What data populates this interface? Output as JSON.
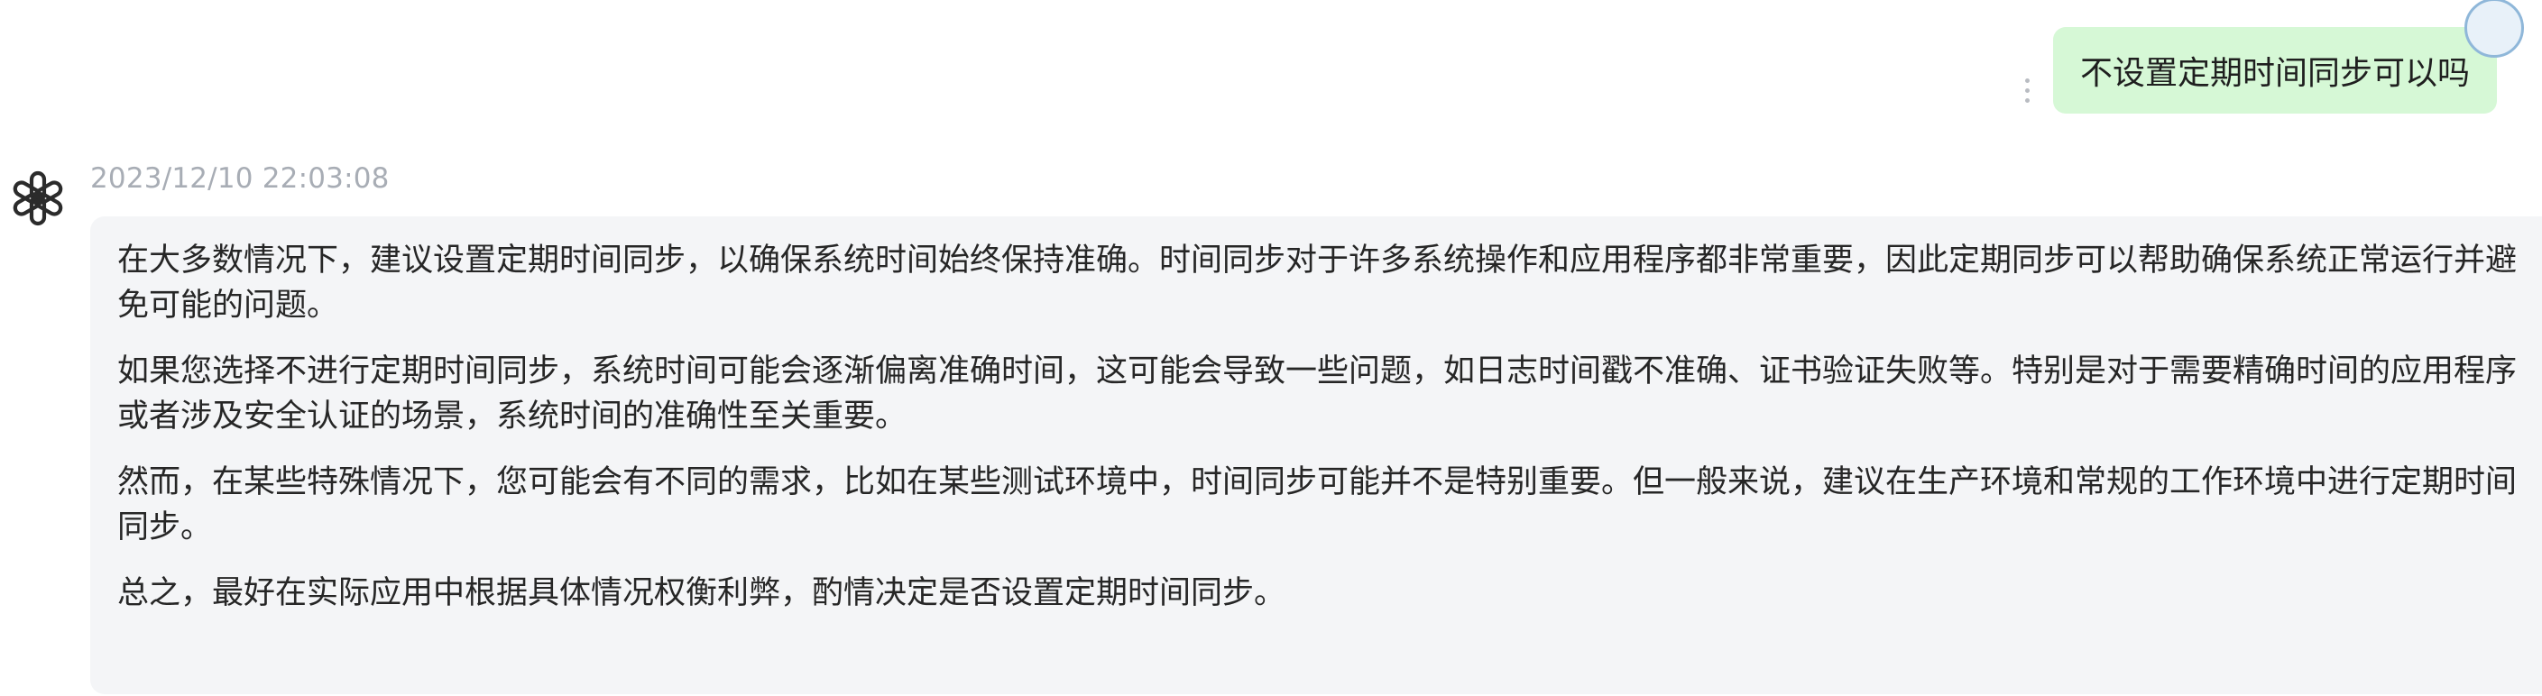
{
  "user_message": {
    "text": "不设置定期时间同步可以吗"
  },
  "assistant_message": {
    "timestamp": "2023/12/10 22:03:08",
    "paragraphs": [
      "在大多数情况下，建议设置定期时间同步，以确保系统时间始终保持准确。时间同步对于许多系统操作和应用程序都非常重要，因此定期同步可以帮助确保系统正常运行并避免可能的问题。",
      "如果您选择不进行定期时间同步，系统时间可能会逐渐偏离准确时间，这可能会导致一些问题，如日志时间戳不准确、证书验证失败等。特别是对于需要精确时间的应用程序或者涉及安全认证的场景，系统时间的准确性至关重要。",
      "然而，在某些特殊情况下，您可能会有不同的需求，比如在某些测试环境中，时间同步可能并不是特别重要。但一般来说，建议在生产环境和常规的工作环境中进行定期时间同步。",
      "总之，最好在实际应用中根据具体情况权衡利弊，酌情决定是否设置定期时间同步。"
    ]
  },
  "icons": {
    "bot_logo": "openai-logo-icon",
    "more": "vertical-dots-icon",
    "avatar": "user-avatar"
  },
  "colors": {
    "user_bubble": "#d6f8d6",
    "answer_background": "#f4f5f7",
    "timestamp": "#a8adb5"
  }
}
